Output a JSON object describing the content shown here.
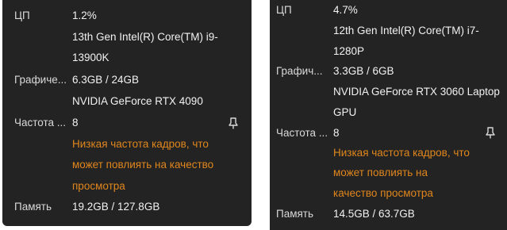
{
  "left": {
    "cpu_label": "ЦП",
    "cpu_value": "1.2%",
    "cpu_model": [
      "13th Gen Intel(R) Core(TM) i9-",
      "13900K"
    ],
    "gpu_label": "Графиче...",
    "gpu_value": "6.3GB / 24GB",
    "gpu_model": "NVIDIA GeForce RTX 4090",
    "fps_label": "Частота ...",
    "fps_value": "8",
    "warning": [
      "Низкая частота кадров, что",
      "может повлиять на качество",
      "просмотра"
    ],
    "mem_label": "Память",
    "mem_value": "19.2GB / 127.8GB",
    "pin_icon": "pin-icon"
  },
  "right": {
    "cpu_label": "ЦП",
    "cpu_value": "4.7%",
    "cpu_model": [
      "12th Gen Intel(R) Core(TM) i7-",
      "1280P"
    ],
    "gpu_label": "Графич...",
    "gpu_value": "3.3GB / 6GB",
    "gpu_model": [
      "NVIDIA GeForce RTX 3060 Laptop",
      "GPU"
    ],
    "fps_label": "Частота ...",
    "fps_value": "8",
    "warning": [
      "Низкая частота кадров, что",
      "может повлиять на",
      "качество просмотра"
    ],
    "mem_label": "Память",
    "mem_value": "14.5GB / 63.7GB",
    "pin_icon": "pin-icon"
  },
  "colors": {
    "panel_bg": "#232323",
    "text": "#ececec",
    "warning": "#e0861d"
  }
}
